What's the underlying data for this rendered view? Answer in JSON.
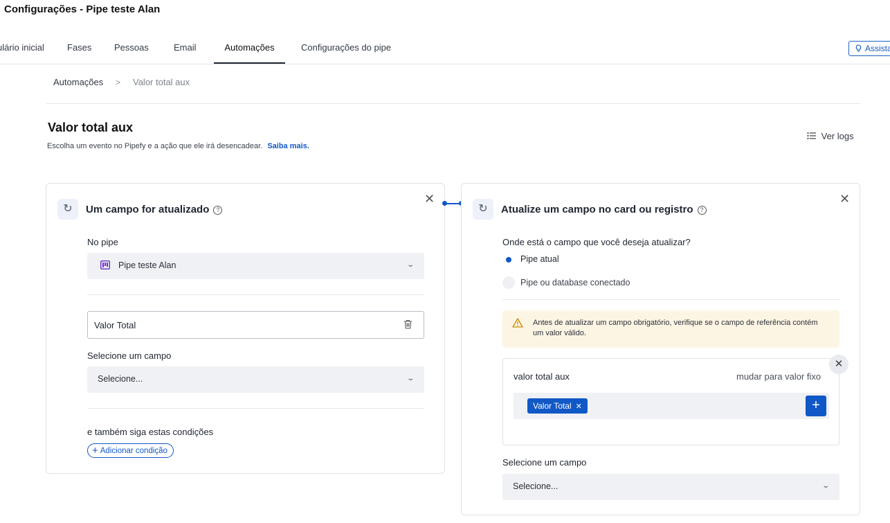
{
  "header": {
    "title": "Configurações - Pipe teste Alan",
    "tabs": [
      {
        "label": "ulário inicial"
      },
      {
        "label": "Fases"
      },
      {
        "label": "Pessoas"
      },
      {
        "label": "Email"
      },
      {
        "label": "Automações"
      },
      {
        "label": "Configurações do pipe"
      }
    ],
    "active_tab": "Automações",
    "assist_label": "Assista",
    "assist_icon": "lightbulb-icon"
  },
  "breadcrumb": {
    "root": "Automações",
    "separator": ">",
    "current": "Valor total aux"
  },
  "main": {
    "title": "Valor total aux",
    "subtitle": "Escolha um evento no Pipefy e a ação que ele irá desencadear.",
    "learn_more": "Saiba mais.",
    "logs_label": "Ver logs",
    "logs_icon": "list-icon"
  },
  "trigger": {
    "icon": "refresh-icon",
    "title": "Um campo for atualizado",
    "pipe_label": "No pipe",
    "pipe_value": "Pipe teste Alan",
    "pipe_icon": "pipe-board-icon",
    "field_value": "Valor Total",
    "select_field_label": "Selecione um campo",
    "select_placeholder": "Selecione...",
    "conditions_label": "e também siga estas condições",
    "add_condition_label": "Adicionar condição"
  },
  "action": {
    "icon": "refresh-icon",
    "title": "Atualize um campo no card ou registro",
    "question": "Onde está o campo que você deseja atualizar?",
    "options": [
      {
        "label": "Pipe atual",
        "selected": true
      },
      {
        "label": "Pipe ou database conectado",
        "selected": false
      }
    ],
    "warning": "Antes de atualizar um campo obrigatório, verifique se o campo de referência contém um valor válido.",
    "field_name": "valor total aux",
    "switch_label": "mudar para valor fixo",
    "chip_label": "Valor Total",
    "select_field_label": "Selecione um campo",
    "select_placeholder": "Selecione..."
  },
  "colors": {
    "accent": "#1158c7",
    "warning_bg": "#fdf5e4",
    "select_bg": "#eff1f4"
  }
}
